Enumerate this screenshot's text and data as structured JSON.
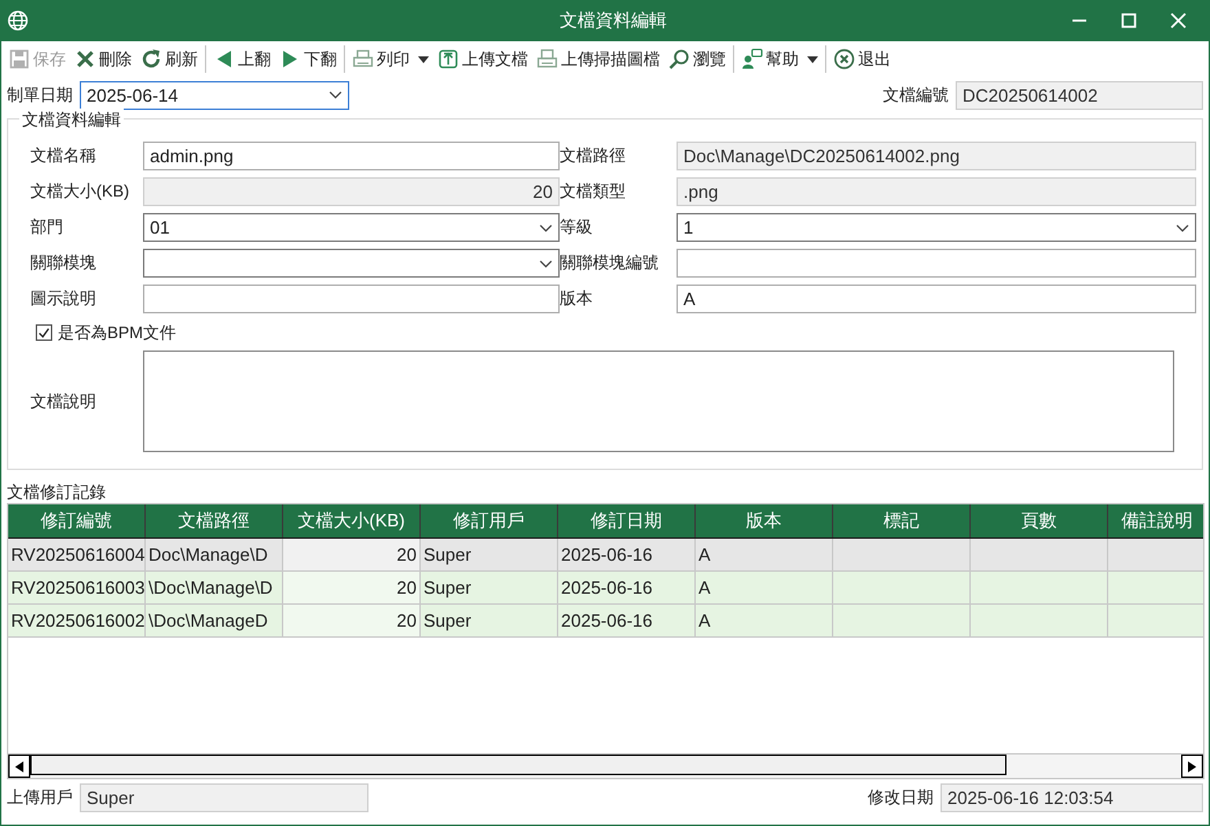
{
  "window": {
    "title": "文檔資料編輯"
  },
  "toolbar": [
    {
      "kind": "save",
      "label": "保存",
      "disabled": true
    },
    {
      "kind": "delete",
      "label": "刪除",
      "disabled": false
    },
    {
      "kind": "refresh",
      "label": "刷新",
      "disabled": false
    },
    {
      "kind": "separator"
    },
    {
      "kind": "prev",
      "label": "上翻",
      "disabled": false
    },
    {
      "kind": "next",
      "label": "下翻",
      "disabled": false
    },
    {
      "kind": "separator"
    },
    {
      "kind": "print",
      "label": "列印",
      "disabled": false,
      "dropdown": true
    },
    {
      "kind": "upload",
      "label": "上傳文檔",
      "disabled": false
    },
    {
      "kind": "scan",
      "label": "上傳掃描圖檔",
      "disabled": false
    },
    {
      "kind": "browse",
      "label": "瀏覽",
      "disabled": false
    },
    {
      "kind": "separator"
    },
    {
      "kind": "help",
      "label": "幫助",
      "disabled": false,
      "dropdown": true
    },
    {
      "kind": "separator"
    },
    {
      "kind": "exit",
      "label": "退出",
      "disabled": false
    }
  ],
  "header": {
    "date": {
      "label": "制單日期",
      "value": "2025-06-14",
      "kind": "dropdown",
      "readonly": false,
      "focused": true
    },
    "number": {
      "label": "文檔編號",
      "value": "DC20250614002",
      "kind": "text",
      "readonly": true
    }
  },
  "group": {
    "title": "文檔資料編輯",
    "fields": [
      {
        "label": "文檔名稱",
        "value": "admin.png",
        "kind": "text",
        "readonly": false
      },
      {
        "label": "文檔路徑",
        "value": "Doc\\Manage\\DC20250614002.png",
        "kind": "text",
        "readonly": true
      },
      {
        "label": "文檔大小(KB)",
        "value": "20",
        "kind": "number",
        "readonly": true
      },
      {
        "label": "文檔類型",
        "value": ".png",
        "kind": "text",
        "readonly": true
      },
      {
        "label": "部門",
        "value": "01",
        "kind": "dropdown",
        "readonly": false
      },
      {
        "label": "等級",
        "value": "1",
        "kind": "dropdown",
        "readonly": false
      },
      {
        "label": "關聯模塊",
        "kind": "dropdown",
        "readonly": false
      },
      {
        "label": "關聯模塊編號",
        "kind": "text",
        "readonly": false
      },
      {
        "label": "圖示說明",
        "kind": "text",
        "readonly": false
      },
      {
        "label": "版本",
        "value": "A",
        "kind": "text",
        "readonly": false
      }
    ],
    "checkbox": {
      "label": "是否為BPM文件",
      "checked": true
    },
    "description": {
      "label": "文檔說明"
    }
  },
  "revisions": {
    "title": "文檔修訂記錄",
    "columns": [
      "修訂編號",
      "文檔路徑",
      "文檔大小(KB)",
      "修訂用戶",
      "修訂日期",
      "版本",
      "標記",
      "頁數",
      "備註說明"
    ],
    "rows": [
      {
        "selected": true,
        "cells": [
          "RV20250616004",
          "Doc\\Manage\\D",
          "20",
          "Super",
          "2025-06-16",
          "A"
        ]
      },
      {
        "selected": false,
        "cells": [
          "RV20250616003",
          "\\Doc\\Manage\\D",
          "20",
          "Super",
          "2025-06-16",
          "A"
        ]
      },
      {
        "selected": false,
        "cells": [
          "RV20250616002",
          "\\Doc\\ManageD",
          "20",
          "Super",
          "2025-06-16",
          "A"
        ]
      }
    ]
  },
  "footer": {
    "user": {
      "label": "上傳用戶",
      "value": "Super",
      "kind": "text",
      "readonly": true
    },
    "modified": {
      "label": "修改日期",
      "value": "2025-06-16 12:03:54",
      "kind": "text",
      "readonly": true
    }
  }
}
